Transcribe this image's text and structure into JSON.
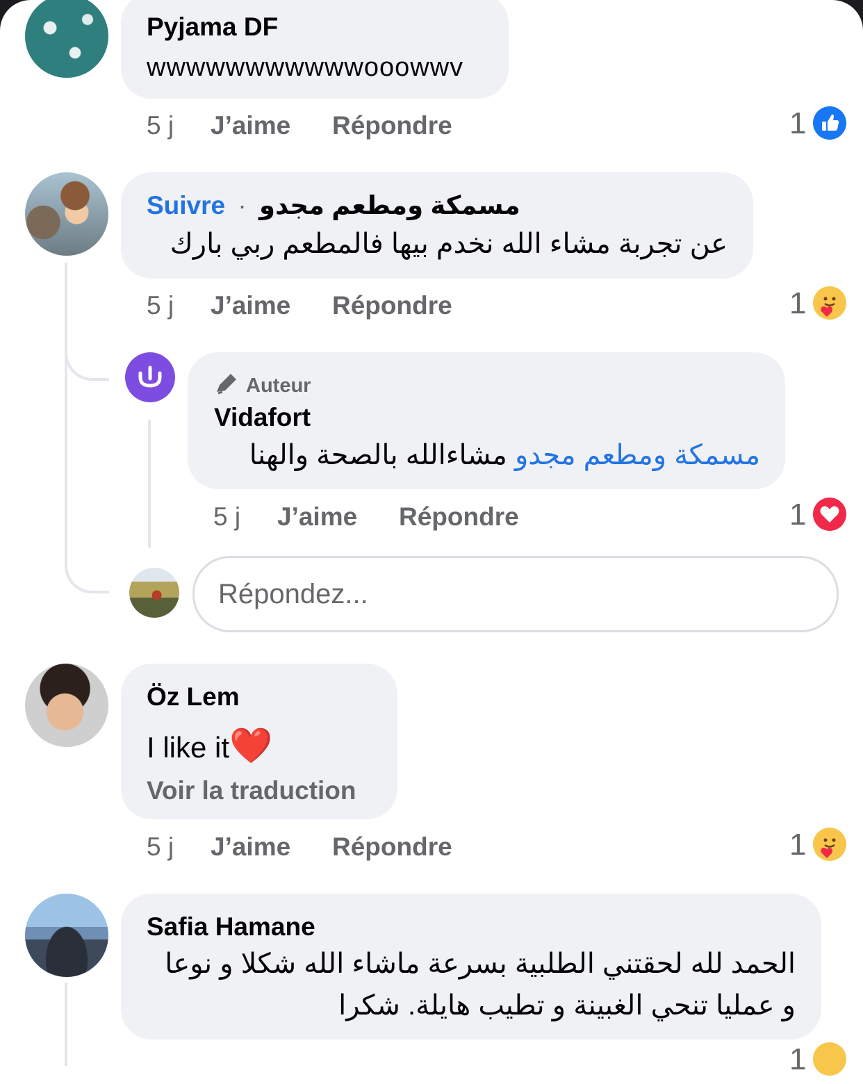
{
  "theme": {
    "bubble_bg": "#f0f1f4",
    "link_blue": "#2374e1",
    "meta_gray": "#65676b",
    "like_blue": "#1877f2",
    "love_red": "#f02849"
  },
  "comments": [
    {
      "author": "Pyjama DF",
      "text": "wwwwwwwwwwwooowwv",
      "actions": {
        "time": "5 j",
        "like": "J’aime",
        "reply": "Répondre"
      },
      "reaction": {
        "count": "1",
        "icon": "like-icon"
      }
    },
    {
      "author": "مسمكة ومطعم مجدو",
      "follow": "Suivre",
      "separator": "·",
      "text": "عن تجربة مشاء الله نخدم بيها فالمطعم ربي بارك",
      "actions": {
        "time": "5 j",
        "like": "J’aime",
        "reply": "Répondre"
      },
      "reaction": {
        "count": "1",
        "icon": "care-icon"
      },
      "reply": {
        "badge": "Auteur",
        "author": "Vidafort",
        "mention": "مسمكة ومطعم مجدو",
        "text": "مشاءالله بالصحة والهنا",
        "actions": {
          "time": "5 j",
          "like": "J’aime",
          "reply": "Répondre"
        },
        "reaction": {
          "count": "1",
          "icon": "love-icon"
        }
      },
      "reply_input": {
        "placeholder": "Répondez..."
      }
    },
    {
      "author": "Öz Lem",
      "text": "I like it",
      "emoji": "❤️",
      "translate": "Voir la traduction",
      "actions": {
        "time": "5 j",
        "like": "J’aime",
        "reply": "Répondre"
      },
      "reaction": {
        "count": "1",
        "icon": "care-icon"
      }
    },
    {
      "author": "Safia Hamane",
      "text_line1": "الحمد لله لحقتني الطلبية بسرعة ماشاء الله شكلا و نوعا",
      "text_line2": "و عمليا  تنحي الغبينة و تطيب هايلة. شكرا",
      "reaction": {
        "count": "1",
        "icon": "care-icon"
      }
    }
  ]
}
